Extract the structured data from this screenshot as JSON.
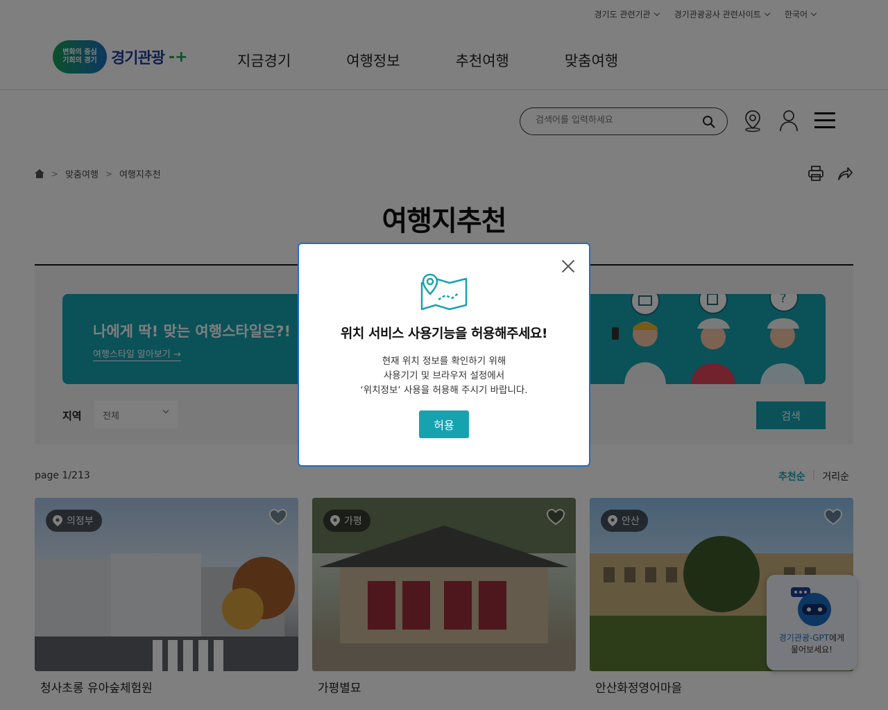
{
  "topbar": {
    "links": [
      "경기도 관련기관",
      "경기관광공사 관련사이트",
      "한국어"
    ]
  },
  "header": {
    "logo_badge": "변화의 중심\n기회의 경기",
    "logo_name": "경기관광",
    "gnb": [
      "지금경기",
      "여행정보",
      "추천여행",
      "맞춤여행"
    ]
  },
  "search": {
    "placeholder": "검색어를 입력하세요"
  },
  "breadcrumb": [
    "맞춤여행",
    "여행지추천"
  ],
  "page_title": "여행지추천",
  "banner": {
    "title": "나에게 딱! 맞는 여행스타일은?!",
    "link": "여행스타일 알아보기 →"
  },
  "filter": {
    "region_label": "지역",
    "region_value": "전체",
    "search_button": "검색"
  },
  "list": {
    "page_info": "page 1/213",
    "sort": [
      "추천순",
      "거리순"
    ],
    "cards": [
      {
        "region": "의정부",
        "name": "청사초롱 유아숲체험원"
      },
      {
        "region": "가평",
        "name": "가평별묘"
      },
      {
        "region": "안산",
        "name": "안산화정영어마을"
      }
    ]
  },
  "gpt": {
    "name": "경기관광-GPT",
    "suffix": "에게",
    "line2": "물어보세요!"
  },
  "modal": {
    "title": "위치 서비스 사용기능을 허용해주세요!",
    "desc_lines": [
      "현재 위치 정보를 확인하기 위해",
      "사용기기 및 브라우저 설정에서",
      "‘위치정보’ 사용을 허용해 주시기 바랍니다."
    ],
    "allow_button": "허용"
  },
  "colors": {
    "accent": "#17a2b0",
    "brand_blue": "#1b6fc4",
    "modal_border": "#1b6fc4"
  }
}
